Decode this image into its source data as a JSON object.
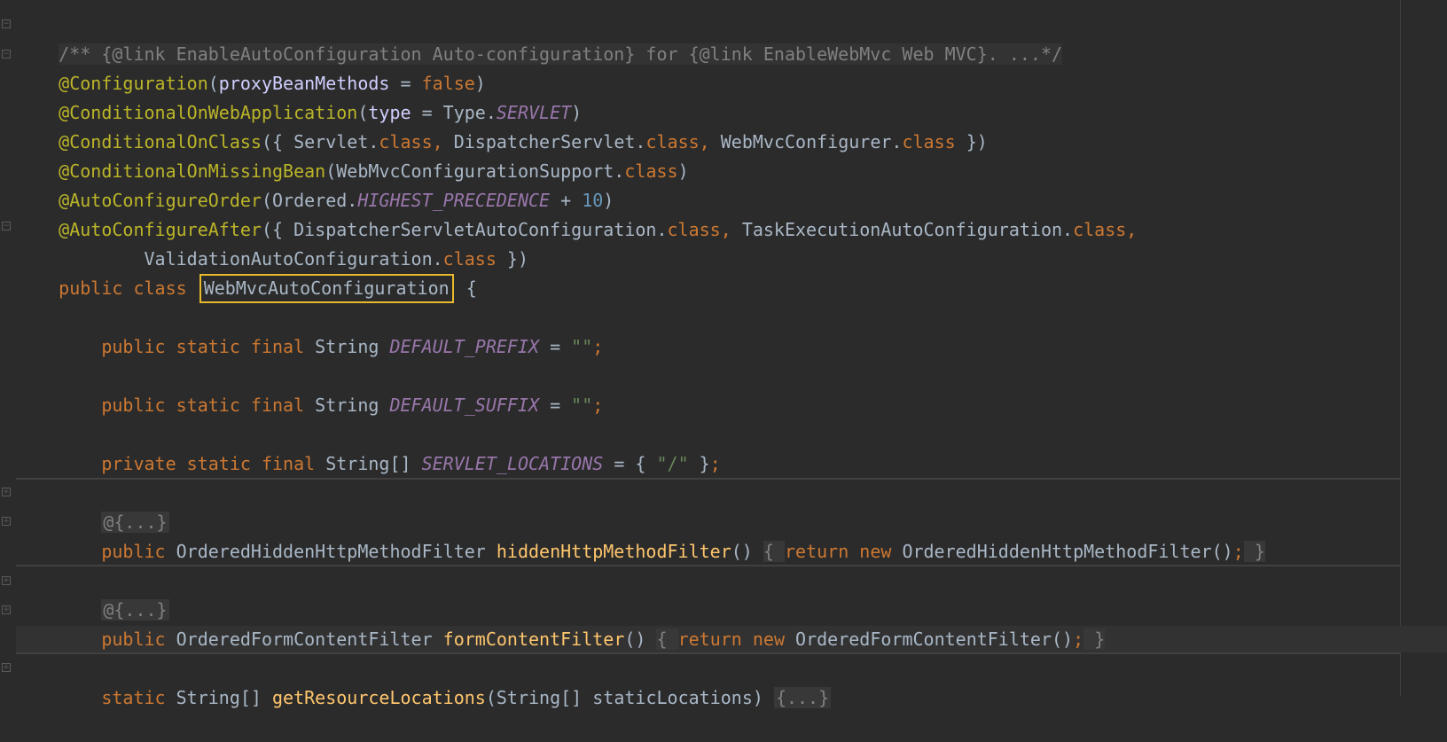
{
  "editor": {
    "line1": {
      "comment": "/** {@link EnableAutoConfiguration Auto-configuration} for {@link EnableWebMvc Web MVC}. ...*/"
    },
    "line2": {
      "ann": "@Configuration",
      "p1": "(",
      "param": "proxyBeanMethods",
      "eq": " = ",
      "val": "false",
      "p2": ")"
    },
    "line3": {
      "ann": "@ConditionalOnWebApplication",
      "p1": "(",
      "param": "type",
      "eq": " = Type.",
      "const": "SERVLET",
      "p2": ")"
    },
    "line4": {
      "ann": "@ConditionalOnClass",
      "t1": "({ Servlet.",
      "k1": "class, ",
      "t2": "DispatcherServlet.",
      "k2": "class, ",
      "t3": "WebMvcConfigurer.",
      "k3": "class",
      "t4": " })"
    },
    "line5": {
      "ann": "@ConditionalOnMissingBean",
      "t1": "(WebMvcConfigurationSupport.",
      "k1": "class",
      "t2": ")"
    },
    "line6": {
      "ann": "@AutoConfigureOrder",
      "t1": "(Ordered.",
      "const": "HIGHEST_PRECEDENCE",
      "t2": " + ",
      "num": "10",
      "t3": ")"
    },
    "line7": {
      "ann": "@AutoConfigureAfter",
      "t1": "({ DispatcherServletAutoConfiguration.",
      "k1": "class, ",
      "t2": "TaskExecutionAutoConfiguration.",
      "k2": "class,"
    },
    "line8": {
      "t1": "        ValidationAutoConfiguration.",
      "k1": "class",
      "t2": " })"
    },
    "line9": {
      "kw": "public class ",
      "cls": "WebMvcAutoConfiguration",
      "t1": " {"
    },
    "line10": {
      "kw": "    public static final ",
      "type": "String ",
      "const": "DEFAULT_PREFIX",
      "eq": " = ",
      "str": "\"\"",
      "semi": ";"
    },
    "line11": {
      "kw": "    public static final ",
      "type": "String ",
      "const": "DEFAULT_SUFFIX",
      "eq": " = ",
      "str": "\"\"",
      "semi": ";"
    },
    "line12": {
      "kw": "    private static final ",
      "type": "String[] ",
      "const": "SERVLET_LOCATIONS",
      "eq": " = { ",
      "str": "\"/\"",
      "t1": " }",
      "semi": ";"
    },
    "line13": {
      "folded": "@{...}"
    },
    "line14": {
      "kw": "    public ",
      "type": "OrderedHiddenHttpMethodFilter ",
      "fn": "hiddenHttpMethodFilter",
      "t1": "() ",
      "b1": "{ ",
      "ret": "return new ",
      "t2": "OrderedHiddenHttpMethodFilter()",
      "semi": ";",
      "b2": " }"
    },
    "line15": {
      "folded": "@{...}"
    },
    "line16": {
      "kw": "    public ",
      "type": "OrderedFormContentFilter ",
      "fn": "formContentFilter",
      "t1": "() ",
      "b1": "{ ",
      "ret": "return new ",
      "t2": "OrderedFormContentFilter()",
      "semi": ";",
      "b2": " }"
    },
    "line17": {
      "kw": "    static ",
      "type": "String[] ",
      "fn": "getResourceLocations",
      "t1": "(String[] staticLocations) ",
      "folded": "{...}"
    }
  }
}
